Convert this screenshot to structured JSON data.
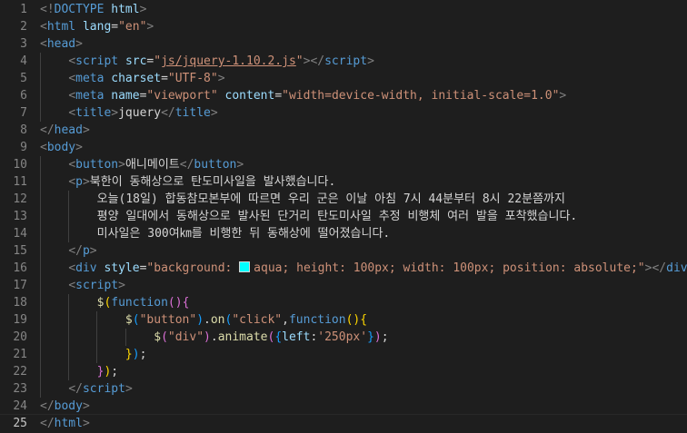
{
  "editor": {
    "language": "html",
    "current_line": 25,
    "lines": [
      [
        [
          "punc",
          "<!"
        ],
        [
          "tag",
          "DOCTYPE"
        ],
        [
          "text",
          " "
        ],
        [
          "attr",
          "html"
        ],
        [
          "punc",
          ">"
        ]
      ],
      [
        [
          "punc",
          "<"
        ],
        [
          "tag",
          "html"
        ],
        [
          "text",
          " "
        ],
        [
          "attr",
          "lang"
        ],
        [
          "eq",
          "="
        ],
        [
          "str",
          "\"en\""
        ],
        [
          "punc",
          ">"
        ]
      ],
      [
        [
          "punc",
          "<"
        ],
        [
          "tag",
          "head"
        ],
        [
          "punc",
          ">"
        ]
      ],
      [
        [
          "text",
          "    "
        ],
        [
          "punc",
          "<"
        ],
        [
          "tag",
          "script"
        ],
        [
          "text",
          " "
        ],
        [
          "attr",
          "src"
        ],
        [
          "eq",
          "="
        ],
        [
          "str",
          "\""
        ],
        [
          "url",
          "js/jquery-1.10.2.js"
        ],
        [
          "str",
          "\""
        ],
        [
          "punc",
          "></"
        ],
        [
          "tag",
          "script"
        ],
        [
          "punc",
          ">"
        ]
      ],
      [
        [
          "text",
          "    "
        ],
        [
          "punc",
          "<"
        ],
        [
          "tag",
          "meta"
        ],
        [
          "text",
          " "
        ],
        [
          "attr",
          "charset"
        ],
        [
          "eq",
          "="
        ],
        [
          "str",
          "\"UTF-8\""
        ],
        [
          "punc",
          ">"
        ]
      ],
      [
        [
          "text",
          "    "
        ],
        [
          "punc",
          "<"
        ],
        [
          "tag",
          "meta"
        ],
        [
          "text",
          " "
        ],
        [
          "attr",
          "name"
        ],
        [
          "eq",
          "="
        ],
        [
          "str",
          "\"viewport\""
        ],
        [
          "text",
          " "
        ],
        [
          "attr",
          "content"
        ],
        [
          "eq",
          "="
        ],
        [
          "str",
          "\"width=device-width, initial-scale=1.0\""
        ],
        [
          "punc",
          ">"
        ]
      ],
      [
        [
          "text",
          "    "
        ],
        [
          "punc",
          "<"
        ],
        [
          "tag",
          "title"
        ],
        [
          "punc",
          ">"
        ],
        [
          "text",
          "jquery"
        ],
        [
          "punc",
          "</"
        ],
        [
          "tag",
          "title"
        ],
        [
          "punc",
          ">"
        ]
      ],
      [
        [
          "punc",
          "</"
        ],
        [
          "tag",
          "head"
        ],
        [
          "punc",
          ">"
        ]
      ],
      [
        [
          "punc",
          "<"
        ],
        [
          "tag",
          "body"
        ],
        [
          "punc",
          ">"
        ]
      ],
      [
        [
          "text",
          "    "
        ],
        [
          "punc",
          "<"
        ],
        [
          "tag",
          "button"
        ],
        [
          "punc",
          ">"
        ],
        [
          "text",
          "애니메이트"
        ],
        [
          "punc",
          "</"
        ],
        [
          "tag",
          "button"
        ],
        [
          "punc",
          ">"
        ]
      ],
      [
        [
          "text",
          "    "
        ],
        [
          "punc",
          "<"
        ],
        [
          "tag",
          "p"
        ],
        [
          "punc",
          ">"
        ],
        [
          "text",
          "북한이 동해상으로 탄도미사일을 발사했습니다."
        ]
      ],
      [
        [
          "text",
          "        오늘(18일) 합동참모본부에 따르면 우리 군은 이날 아침 7시 44분부터 8시 22분쯤까지"
        ]
      ],
      [
        [
          "text",
          "        평양 일대에서 동해상으로 발사된 단거리 탄도미사일 추정 비행체 여러 발을 포착했습니다."
        ]
      ],
      [
        [
          "text",
          "        미사일은 300여㎞를 비행한 뒤 동해상에 떨어졌습니다."
        ]
      ],
      [
        [
          "text",
          "    "
        ],
        [
          "punc",
          "</"
        ],
        [
          "tag",
          "p"
        ],
        [
          "punc",
          ">"
        ]
      ],
      [
        [
          "text",
          "    "
        ],
        [
          "punc",
          "<"
        ],
        [
          "tag",
          "div"
        ],
        [
          "text",
          " "
        ],
        [
          "attr",
          "style"
        ],
        [
          "eq",
          "="
        ],
        [
          "str",
          "\"background: "
        ],
        [
          "swatch",
          ""
        ],
        [
          "str",
          "aqua; height: 100px; width: 100px; position: absolute;\""
        ],
        [
          "punc",
          "></"
        ],
        [
          "tag",
          "div"
        ],
        [
          "punc",
          ">"
        ]
      ],
      [
        [
          "text",
          "    "
        ],
        [
          "punc",
          "<"
        ],
        [
          "tag",
          "script"
        ],
        [
          "punc",
          ">"
        ]
      ],
      [
        [
          "text",
          "        "
        ],
        [
          "fn",
          "$"
        ],
        [
          "br1",
          "("
        ],
        [
          "kw",
          "function"
        ],
        [
          "br2",
          "("
        ],
        [
          "br2",
          ")"
        ],
        [
          "br2",
          "{"
        ]
      ],
      [
        [
          "text",
          "            "
        ],
        [
          "fn",
          "$"
        ],
        [
          "br3",
          "("
        ],
        [
          "str",
          "\"button\""
        ],
        [
          "br3",
          ")"
        ],
        [
          "text",
          "."
        ],
        [
          "fn",
          "on"
        ],
        [
          "br3",
          "("
        ],
        [
          "str",
          "\"click\""
        ],
        [
          "text",
          ","
        ],
        [
          "kw",
          "function"
        ],
        [
          "br1",
          "("
        ],
        [
          "br1",
          ")"
        ],
        [
          "br1",
          "{"
        ]
      ],
      [
        [
          "text",
          "                "
        ],
        [
          "fn",
          "$"
        ],
        [
          "br2",
          "("
        ],
        [
          "str",
          "\"div\""
        ],
        [
          "br2",
          ")"
        ],
        [
          "text",
          "."
        ],
        [
          "fn",
          "animate"
        ],
        [
          "br2",
          "("
        ],
        [
          "br3",
          "{"
        ],
        [
          "attr",
          "left"
        ],
        [
          "text",
          ":"
        ],
        [
          "str",
          "'250px'"
        ],
        [
          "br3",
          "}"
        ],
        [
          "br2",
          ")"
        ],
        [
          "text",
          ";"
        ]
      ],
      [
        [
          "text",
          "            "
        ],
        [
          "br1",
          "}"
        ],
        [
          "br3",
          ")"
        ],
        [
          "text",
          ";"
        ]
      ],
      [
        [
          "text",
          "        "
        ],
        [
          "br2",
          "}"
        ],
        [
          "br1",
          ")"
        ],
        [
          "text",
          ";"
        ]
      ],
      [
        [
          "text",
          "    "
        ],
        [
          "punc",
          "</"
        ],
        [
          "tag",
          "script"
        ],
        [
          "punc",
          ">"
        ]
      ],
      [
        [
          "punc",
          "</"
        ],
        [
          "tag",
          "body"
        ],
        [
          "punc",
          ">"
        ]
      ],
      [
        [
          "punc",
          "</"
        ],
        [
          "tag",
          "html"
        ],
        [
          "punc",
          ">"
        ]
      ]
    ]
  }
}
